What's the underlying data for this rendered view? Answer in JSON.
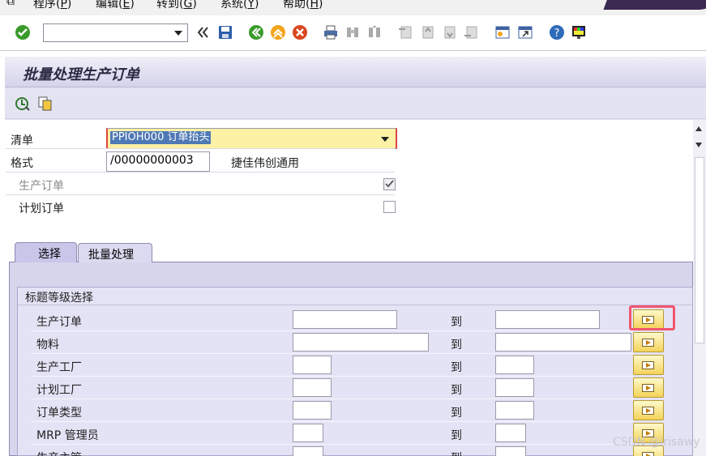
{
  "menu": {
    "items": [
      {
        "label": "程序(",
        "key": "P",
        ")": ")"
      },
      {
        "label": "编辑(",
        "key": "E"
      },
      {
        "label": "转到(",
        "key": "G"
      },
      {
        "label": "系统(",
        "key": "Y"
      },
      {
        "label": "帮助(",
        "key": "H"
      }
    ],
    "close": ")"
  },
  "toolbar": {
    "command_field_value": "",
    "icons": [
      "check-icon",
      "back-icon",
      "exit-icon",
      "cancel-icon",
      "save-icon",
      "print-icon",
      "find-icon",
      "find-next-icon",
      "first-page-icon",
      "prev-page-icon",
      "next-page-icon",
      "last-page-icon",
      "new-session-icon",
      "shortcut-icon",
      "help-icon",
      "layout-icon"
    ]
  },
  "page": {
    "title": "批量处理生产订单",
    "app_icons": [
      "execute-icon",
      "copy-variant-icon"
    ]
  },
  "form": {
    "list_label": "清单",
    "list_value": "PPIOH000 订单抬头",
    "layout_label": "格式",
    "layout_value": "/00000000003",
    "layout_desc": "捷佳伟创通用",
    "prod_order_label": "生产订单",
    "prod_order_checked": true,
    "plan_order_label": "计划订单",
    "plan_order_checked": false
  },
  "tabs": [
    {
      "label": "选择",
      "active": true
    },
    {
      "label": "批量处理",
      "active": false
    }
  ],
  "group": {
    "title": "标题等级选择",
    "to_label": "到",
    "rows": [
      {
        "label": "生产订单",
        "from": "",
        "to": ""
      },
      {
        "label": "物料",
        "from": "",
        "to": ""
      },
      {
        "label": "生产工厂",
        "from": "",
        "to": ""
      },
      {
        "label": "计划工厂",
        "from": "",
        "to": ""
      },
      {
        "label": "订单类型",
        "from": "",
        "to": ""
      },
      {
        "label": "MRP 管理员",
        "from": "",
        "to": ""
      },
      {
        "label": "生产主管",
        "from": "",
        "to": ""
      }
    ]
  },
  "watermark": "CSDN @irisawy",
  "colors": {
    "highlight": "#f0566e",
    "panel": "#e4e3f5",
    "required_field": "#fdf1a5"
  }
}
